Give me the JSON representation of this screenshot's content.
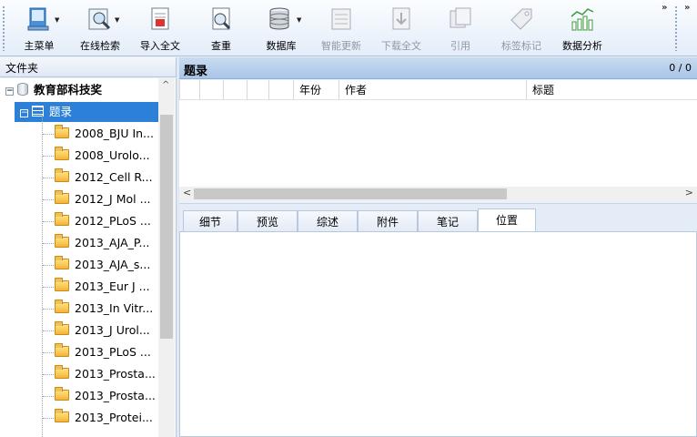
{
  "toolbar": {
    "buttons": [
      {
        "label": "主菜单",
        "icon": "main-menu-icon",
        "enabled": true
      },
      {
        "label": "在线检索",
        "icon": "online-search-icon",
        "enabled": true
      },
      {
        "label": "导入全文",
        "icon": "import-fulltext-icon",
        "enabled": true
      },
      {
        "label": "查重",
        "icon": "duplicate-check-icon",
        "enabled": true
      },
      {
        "label": "数据库",
        "icon": "database-icon",
        "enabled": true
      },
      {
        "label": "智能更新",
        "icon": "smart-update-icon",
        "enabled": false
      },
      {
        "label": "下载全文",
        "icon": "download-fulltext-icon",
        "enabled": false
      },
      {
        "label": "引用",
        "icon": "cite-icon",
        "enabled": false
      },
      {
        "label": "标签标记",
        "icon": "tag-icon",
        "enabled": false
      },
      {
        "label": "数据分析",
        "icon": "data-analysis-icon",
        "enabled": true
      }
    ],
    "overflow": "»"
  },
  "folders": {
    "title": "文件夹",
    "root": "教育部科技奖",
    "selected": "题录",
    "items": [
      "2008_BJU In...",
      "2008_Urolo...",
      "2012_Cell R...",
      "2012_J Mol ...",
      "2012_PLoS ...",
      "2013_AJA_P...",
      "2013_AJA_s...",
      "2013_Eur J ...",
      "2013_In Vitr...",
      "2013_J Urol...",
      "2013_PLoS ...",
      "2013_Prosta...",
      "2013_Prosta...",
      "2013_Protei..."
    ]
  },
  "records": {
    "title": "题录",
    "count": "0 / 0",
    "columns": [
      "年份",
      "作者",
      "标题"
    ]
  },
  "tabs": {
    "items": [
      "细节",
      "预览",
      "综述",
      "附件",
      "笔记",
      "位置"
    ],
    "active": "位置"
  },
  "colors": {
    "selection": "#2d80d7",
    "header_bg": "#a9c5e7",
    "toolbar_bg": "#e4edf9"
  }
}
